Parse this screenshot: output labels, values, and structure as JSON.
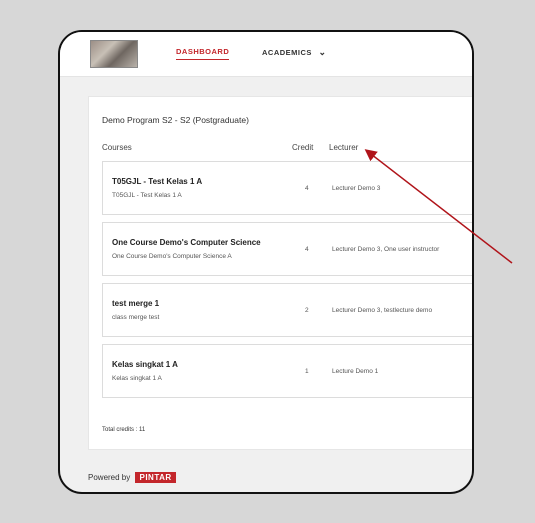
{
  "nav": {
    "dashboard_label": "DASHBOARD",
    "academics_label": "ACADEMICS"
  },
  "program": {
    "title": "Demo Program S2 - S2 (Postgraduate)"
  },
  "table": {
    "headers": {
      "courses": "Courses",
      "credit": "Credit",
      "lecturer": "Lecturer"
    },
    "rows": [
      {
        "name": "T05GJL - Test Kelas 1 A",
        "sub": "T05GJL - Test Kelas 1 A",
        "credit": "4",
        "lecturer": "Lecturer Demo 3"
      },
      {
        "name": "One Course Demo's Computer Science",
        "sub": "One Course Demo's Computer Science A",
        "credit": "4",
        "lecturer": "Lecturer Demo 3, One user instructor"
      },
      {
        "name": "test merge 1",
        "sub": "class merge test",
        "credit": "2",
        "lecturer": "Lecturer Demo 3, testlecture demo"
      },
      {
        "name": "Kelas singkat 1 A",
        "sub": "Kelas singkat 1 A",
        "credit": "1",
        "lecturer": "Lecture Demo 1"
      }
    ]
  },
  "total_credits": "Total credits : 11",
  "footer": {
    "powered_by": "Powered by",
    "brand": "PINTAR"
  },
  "colors": {
    "accent": "#c3262b",
    "annotation_arrow": "#b0141a"
  },
  "icons": {
    "academics_dropdown": "chevron-down-icon"
  }
}
